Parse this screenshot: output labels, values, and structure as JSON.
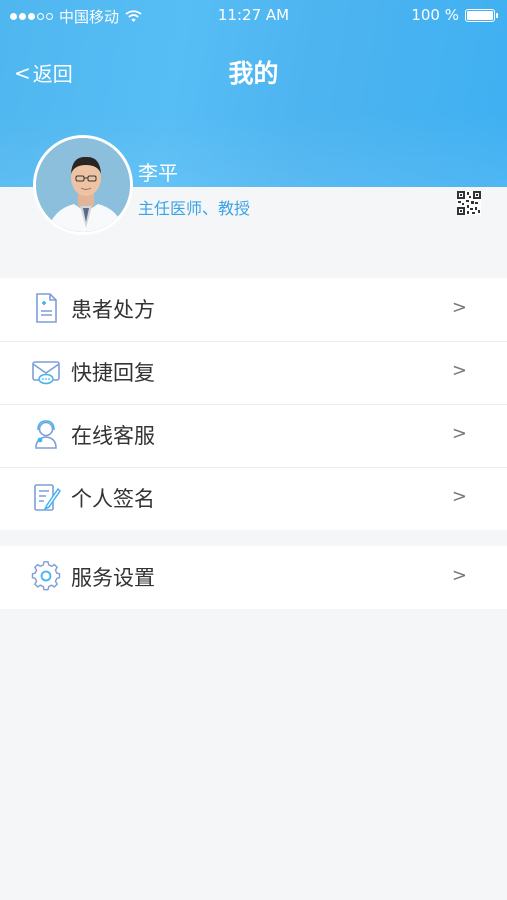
{
  "status_bar": {
    "carrier": "中国移动",
    "time": "11:27 AM",
    "battery": "100 %",
    "signal_bars": 3,
    "signal_total": 5
  },
  "nav": {
    "back_label": "返回",
    "title": "我的"
  },
  "profile": {
    "name": "李平",
    "role": "主任医师、教授"
  },
  "menu_groups": [
    {
      "items": [
        {
          "label": "患者处方",
          "icon": "prescription-icon"
        },
        {
          "label": "快捷回复",
          "icon": "mail-chat-icon"
        },
        {
          "label": "在线客服",
          "icon": "customer-service-icon"
        },
        {
          "label": "个人签名",
          "icon": "signature-icon"
        }
      ]
    },
    {
      "items": [
        {
          "label": "服务设置",
          "icon": "gear-icon"
        }
      ]
    }
  ],
  "colors": {
    "header": "#4fb6ef",
    "accent": "#3aa3e6",
    "background": "#f5f6f8",
    "text": "#333333"
  }
}
